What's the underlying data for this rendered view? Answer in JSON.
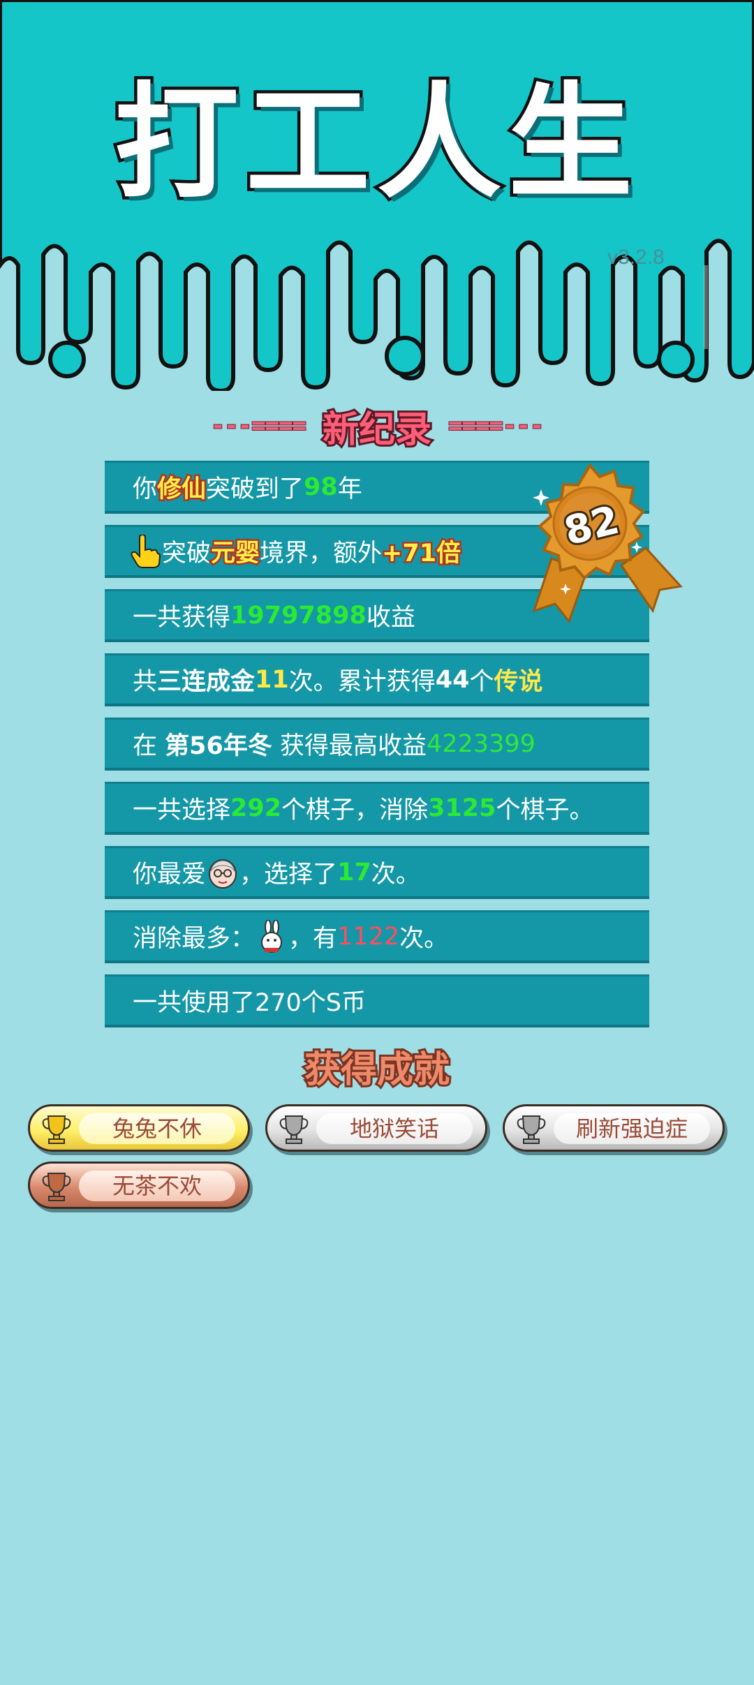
{
  "header": {
    "title": "打工人生",
    "version": "v3.2.8"
  },
  "record": {
    "title": "新纪录",
    "deco_left": "---====",
    "deco_right": "====---"
  },
  "medal": {
    "value": "82"
  },
  "stats": {
    "r1": {
      "a": "你",
      "b": "修仙",
      "c": "突破到了",
      "d": "98",
      "e": "年"
    },
    "r2": {
      "a": "突破",
      "b": "元婴",
      "c": "境界，额外",
      "d": "+71倍"
    },
    "r3": {
      "a": "一共获得",
      "b": "19797898",
      "c": "收益"
    },
    "r4": {
      "a": "共",
      "b": "三连成金",
      "c": "11",
      "d": "次。累计获得",
      "e": "44",
      "f": "个",
      "g": "传说"
    },
    "r5": {
      "a": "在 ",
      "b": "第56年冬",
      "c": " 获得最高收益",
      "d": "4223399"
    },
    "r6": {
      "a": "一共选择",
      "b": "292",
      "c": "个棋子，消除",
      "d": "3125",
      "e": "个棋子。"
    },
    "r7": {
      "a": "你最爱",
      "b": "，选择了",
      "c": "17",
      "d": "次。"
    },
    "r8": {
      "a": "消除最多：",
      "b": "，有",
      "c": "1122",
      "d": "次。"
    },
    "r9": {
      "a": "一共使用了270个S币"
    }
  },
  "icons": {
    "r2": "hand-pointer-icon",
    "r7": "old-man-face-icon",
    "r8": "rabbit-icon"
  },
  "achievements": {
    "title": "获得成就",
    "items": [
      {
        "label": "兔兔不休",
        "tier": "gold"
      },
      {
        "label": "地狱笑话",
        "tier": "silver"
      },
      {
        "label": "刷新强迫症",
        "tier": "silver"
      },
      {
        "label": "无茶不欢",
        "tier": "bronze"
      }
    ]
  },
  "colors": {
    "header_bg": "#14c6c8",
    "page_bg": "#a0dee6",
    "row_bg": "#1497a6",
    "highlight_green": "#2bea34",
    "highlight_yellow": "#ffe94a",
    "highlight_red": "#ff4e5e",
    "record_pink": "#ff5e78"
  }
}
